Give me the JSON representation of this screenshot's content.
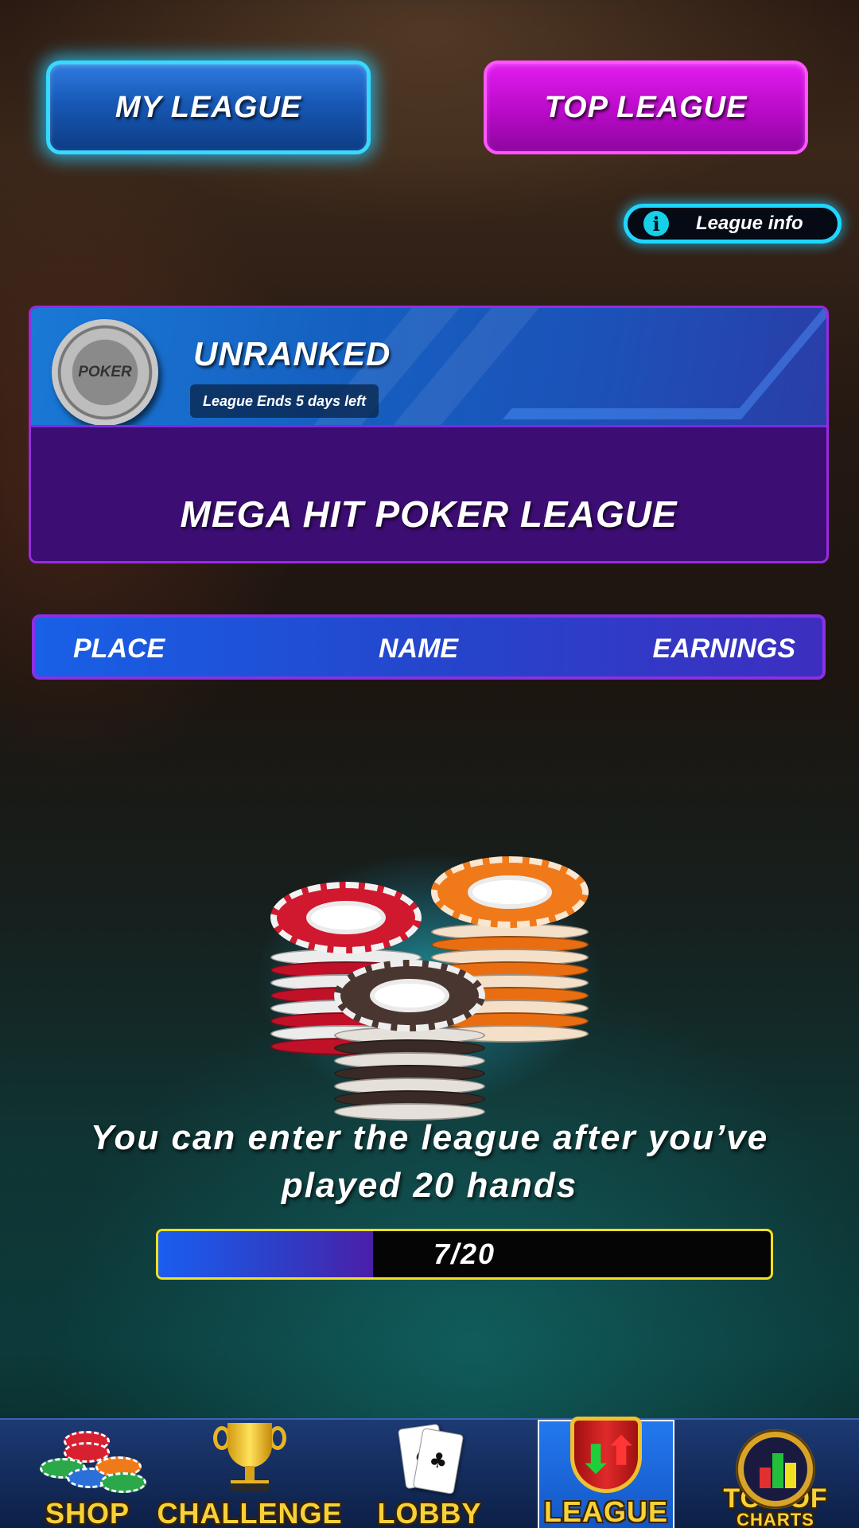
{
  "tabs": {
    "my_league": "MY LEAGUE",
    "top_league": "TOP LEAGUE"
  },
  "league_info": {
    "icon": "info-icon",
    "icon_glyph": "i",
    "label": "League info"
  },
  "league_card": {
    "chip_text": "POKER",
    "rank": "UNRANKED",
    "ends_text": "League Ends 5 days left",
    "league_name": "MEGA HIT POKER LEAGUE"
  },
  "table": {
    "columns": [
      "PLACE",
      "NAME",
      "EARNINGS"
    ]
  },
  "entry": {
    "message": "You can enter the league after you’ve played 20 hands",
    "progress_current": 7,
    "progress_total": 20,
    "progress_text": "7/20"
  },
  "nav": {
    "active": "league",
    "items": [
      {
        "id": "shop",
        "label": "SHOP",
        "icon": "chips-icon"
      },
      {
        "id": "challenge",
        "label": "CHALLENGE",
        "icon": "trophy-icon"
      },
      {
        "id": "lobby",
        "label": "LOBBY",
        "icon": "cards-icon"
      },
      {
        "id": "league",
        "label": "LEAGUE",
        "icon": "shield-arrows-icon"
      },
      {
        "id": "top_of_charts",
        "label": "TOP OF",
        "label2": "CHARTS",
        "icon": "bar-chart-icon"
      }
    ]
  },
  "colors": {
    "accent_cyan": "#20d6ff",
    "tab_blue": "#1758b5",
    "tab_magenta": "#b80ac8",
    "card_purple": "#3c0d72",
    "progress_border": "#f2e020",
    "nav_label": "#f6d23a"
  }
}
